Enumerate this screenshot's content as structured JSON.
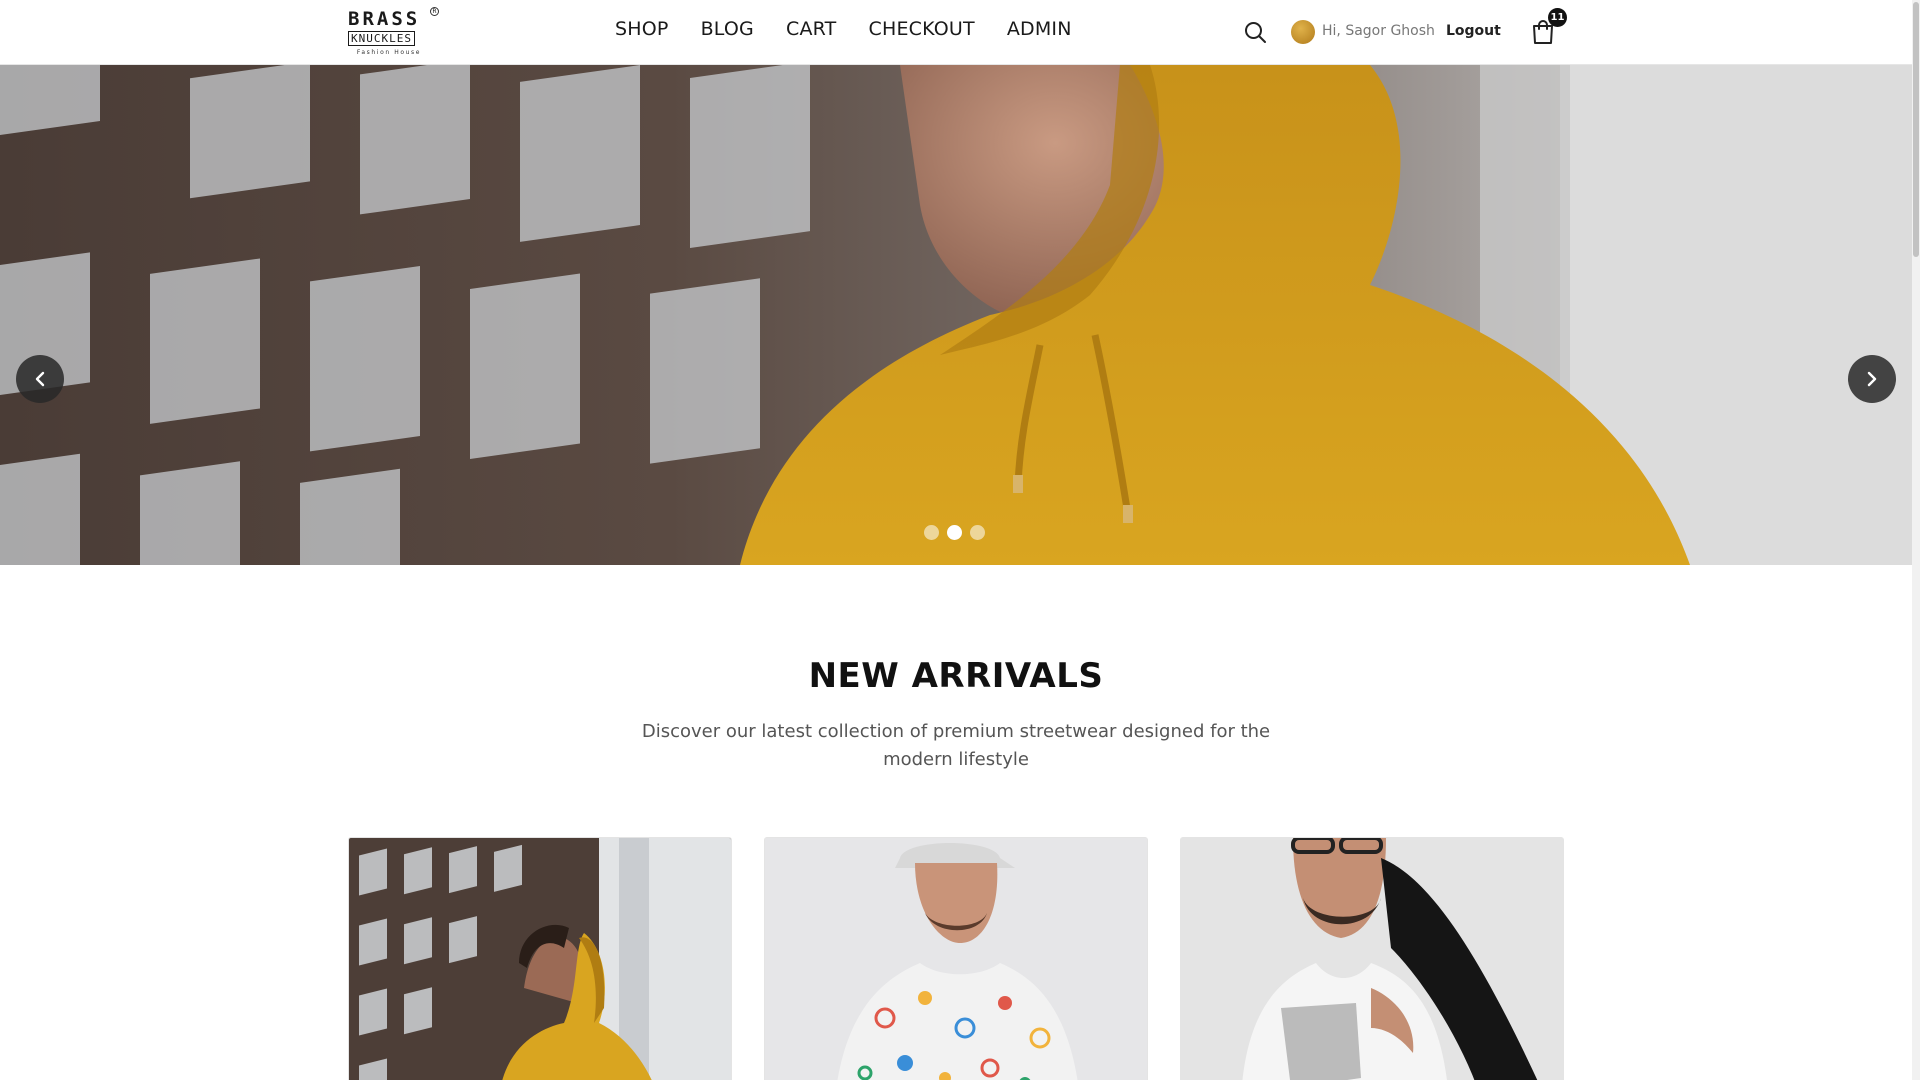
{
  "brand": {
    "line1": "BRASS",
    "line2": "KNUCKLES",
    "line3": "Fashion House",
    "reg_mark": "R"
  },
  "nav": {
    "items": [
      {
        "label": "SHOP"
      },
      {
        "label": "BLOG"
      },
      {
        "label": "CART"
      },
      {
        "label": "CHECKOUT"
      },
      {
        "label": "ADMIN"
      }
    ]
  },
  "user": {
    "greeting": "Hi, Sagor Ghosh",
    "logout_label": "Logout"
  },
  "cart": {
    "count": "11"
  },
  "hero": {
    "slides_total": 3,
    "active_slide": 2,
    "accent_color": "#d9a520"
  },
  "new_arrivals": {
    "title": "NEW ARRIVALS",
    "subtitle": "Discover our latest collection of premium streetwear designed for the modern lifestyle"
  },
  "icons": {
    "search": "search-icon",
    "cart": "shopping-bag-icon",
    "prev": "chevron-left-icon",
    "next": "chevron-right-icon"
  }
}
